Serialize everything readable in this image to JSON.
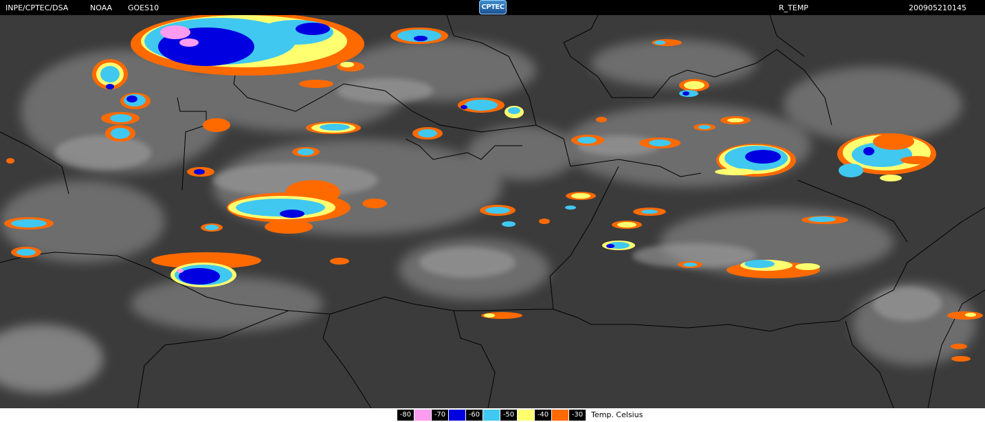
{
  "header": {
    "source": "INPE/CPTEC/DSA",
    "agency": "NOAA",
    "satellite": "GOES10",
    "logo_text": "CPTEC",
    "product": "R_TEMP",
    "timestamp": "200905210145"
  },
  "legend": {
    "unit_label": "Temp. Celsius",
    "entries": [
      {
        "label": "-80",
        "color": "#ff9cf0"
      },
      {
        "label": "-70",
        "color": "#0000e0"
      },
      {
        "label": "-60",
        "color": "#40c8f0"
      },
      {
        "label": "-50",
        "color": "#ffff70"
      },
      {
        "label": "-40",
        "color": "#ff6a00"
      },
      {
        "label": "-30",
        "color": null
      }
    ]
  },
  "map": {
    "background_color": "#3a3a3a",
    "cloud_color": "#8a8a8a",
    "border_color": "#000000"
  }
}
